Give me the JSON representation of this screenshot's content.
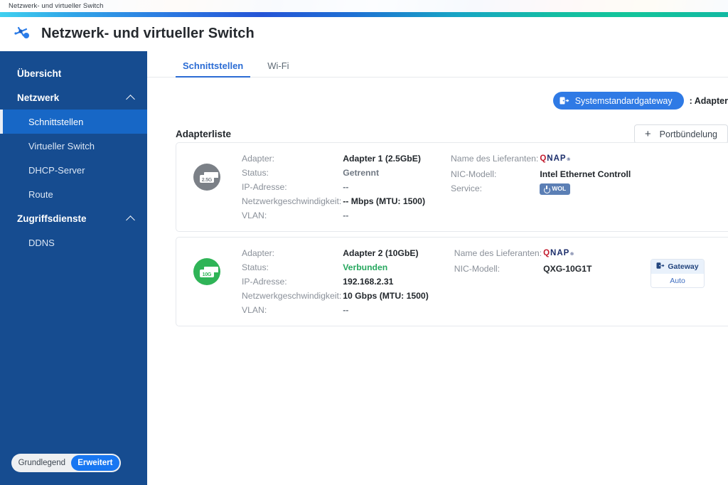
{
  "window": {
    "titlebar_text": "Netzwerk- und virtueller Switch",
    "app_title": "Netzwerk- und virtueller Switch",
    "app_icon": "network-switch-icon"
  },
  "sidebar": {
    "items": [
      {
        "label": "Übersicht",
        "type": "group",
        "expandable": false
      },
      {
        "label": "Netzwerk",
        "type": "group",
        "expandable": true,
        "chevron": "chevron-up-icon"
      },
      {
        "label": "Schnittstellen",
        "type": "item",
        "active": true
      },
      {
        "label": "Virtueller Switch",
        "type": "item",
        "active": false
      },
      {
        "label": "DHCP-Server",
        "type": "item",
        "active": false
      },
      {
        "label": "Route",
        "type": "item",
        "active": false
      },
      {
        "label": "Zugriffsdienste",
        "type": "group",
        "expandable": true,
        "chevron": "chevron-up-icon"
      },
      {
        "label": "DDNS",
        "type": "item",
        "active": false
      }
    ],
    "mode_toggle": {
      "basic_label": "Grundlegend",
      "advanced_label": "Erweitert",
      "selected": "Erweitert"
    }
  },
  "tabs": [
    {
      "label": "Schnittstellen",
      "active": true
    },
    {
      "label": "Wi-Fi",
      "active": false
    }
  ],
  "gateway_bar": {
    "chip_icon": "gateway-icon",
    "chip_label": "Systemstandardgateway",
    "separator_label": ": Adapter"
  },
  "list": {
    "title": "Adapterliste",
    "port_trunking_button": {
      "icon": "plus-icon",
      "label": "Portbündelung"
    }
  },
  "labels": {
    "adapter": "Adapter:",
    "status": "Status:",
    "ip": "IP-Adresse:",
    "speed": "Netzwerkgeschwindigkeit:",
    "vlan": "VLAN:",
    "vendor": "Name des Lieferanten:",
    "nic_model": "NIC-Modell:",
    "service": "Service:"
  },
  "adapters": [
    {
      "badge_speed": "2.5G",
      "badge_color": "#7b8087",
      "adapter": "Adapter 1 (2.5GbE)",
      "status": "Getrennt",
      "status_state": "disconnected",
      "ip": "--",
      "speed": "-- Mbps (MTU: 1500)",
      "vlan": "--",
      "vendor": "QNAP",
      "nic_model": "Intel Ethernet Controll",
      "service_badge": "WOL",
      "has_gateway_box": false
    },
    {
      "badge_speed": "10G",
      "badge_color": "#2fb457",
      "adapter": "Adapter 2 (10GbE)",
      "status": "Verbunden",
      "status_state": "connected",
      "ip": "192.168.2.31",
      "speed": "10 Gbps (MTU: 1500)",
      "vlan": "--",
      "vendor": "QNAP",
      "nic_model": "QXG-10G1T",
      "service_badge": null,
      "has_gateway_box": true,
      "gateway_box": {
        "icon": "gateway-icon",
        "title": "Gateway",
        "mode": "Auto"
      }
    }
  ],
  "colors": {
    "sidebar_bg": "#164c90",
    "sidebar_active": "#1767c6",
    "accent_blue": "#2b6cd4",
    "connected_green": "#27a85f",
    "chip_blue": "#2f7ae5"
  }
}
